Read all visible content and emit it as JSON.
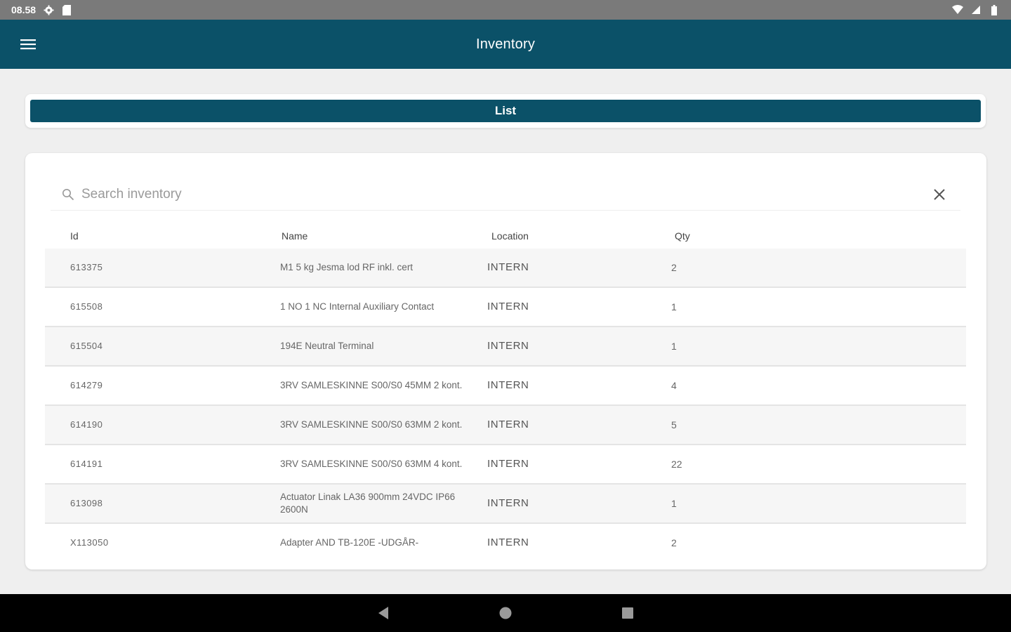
{
  "status_bar": {
    "time": "08.58",
    "icons_left": [
      "gear-icon",
      "sd-card-icon"
    ],
    "icons_right": [
      "wifi-icon",
      "signal-icon",
      "battery-icon"
    ]
  },
  "app_bar": {
    "title": "Inventory",
    "menu_icon": "hamburger-menu-icon",
    "color": "#0b5168"
  },
  "list_button": {
    "label": "List"
  },
  "search": {
    "placeholder": "Search inventory",
    "value": ""
  },
  "table": {
    "columns": {
      "id": "Id",
      "name": "Name",
      "location": "Location",
      "qty": "Qty"
    },
    "rows": [
      {
        "id": "613375",
        "name": "M1 5 kg Jesma lod RF inkl. cert",
        "location": "INTERN",
        "qty": "2"
      },
      {
        "id": "615508",
        "name": "1 NO 1 NC Internal Auxiliary Contact",
        "location": "INTERN",
        "qty": "1"
      },
      {
        "id": "615504",
        "name": "194E Neutral Terminal",
        "location": "INTERN",
        "qty": "1"
      },
      {
        "id": "614279",
        "name": "3RV SAMLESKINNE S00/S0 45MM 2 kont.",
        "location": "INTERN",
        "qty": "4"
      },
      {
        "id": "614190",
        "name": "3RV SAMLESKINNE S00/S0 63MM 2 kont.",
        "location": "INTERN",
        "qty": "5"
      },
      {
        "id": "614191",
        "name": "3RV SAMLESKINNE S00/S0 63MM 4 kont.",
        "location": "INTERN",
        "qty": "22"
      },
      {
        "id": "613098",
        "name": "Actuator Linak LA36 900mm 24VDC IP66 2600N",
        "location": "INTERN",
        "qty": "1"
      },
      {
        "id": "X113050",
        "name": "Adapter AND TB-120E -UDGÅR-",
        "location": "INTERN",
        "qty": "2"
      }
    ]
  },
  "nav_bar": {
    "icons": [
      "back-icon",
      "home-icon",
      "recents-icon"
    ]
  }
}
